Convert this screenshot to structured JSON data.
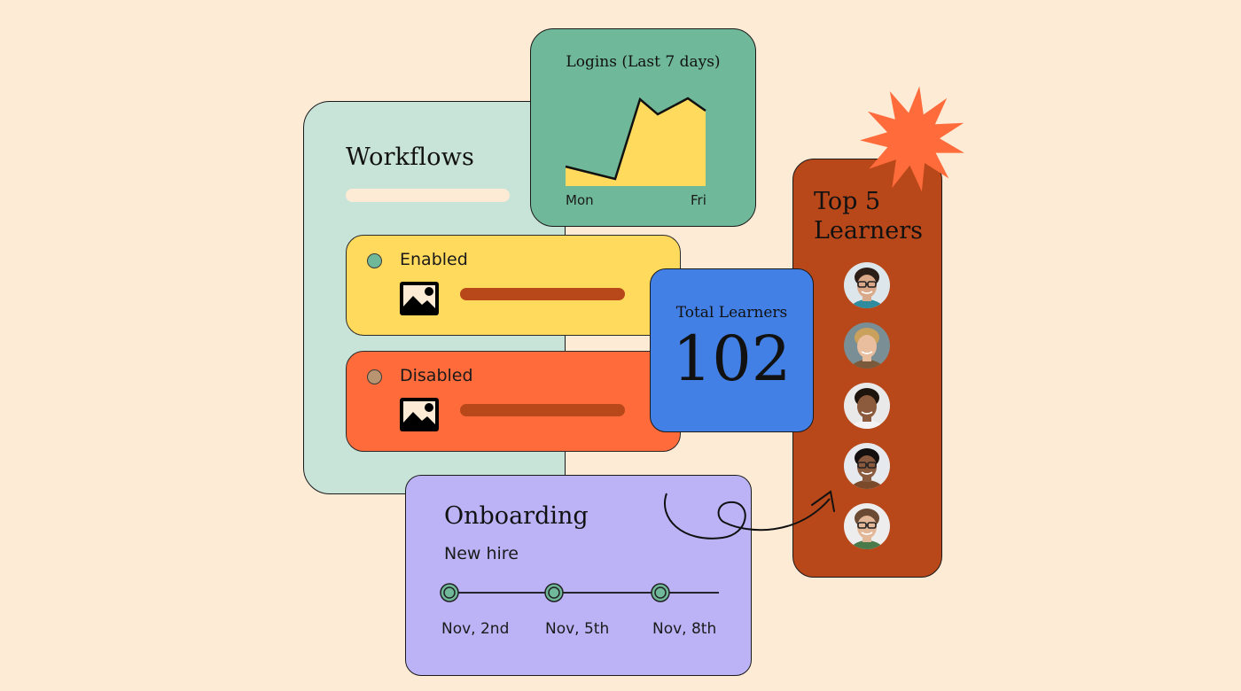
{
  "colors": {
    "background": "#FEEBD6",
    "workflows_panel": "#C8E3D8",
    "enabled_card": "#FFDA5C",
    "disabled_card": "#FF6B3A",
    "enabled_dot": "#6FB899",
    "disabled_dot": "#B89570",
    "logins_card": "#6FB899",
    "chart_fill": "#FFDA5C",
    "total_card": "#4280E6",
    "top5_card": "#B8481A",
    "starburst": "#FF6B3A",
    "onboarding_card": "#BCB3F7",
    "timeline_dot": "#6FB899"
  },
  "workflows": {
    "title": "Workflows",
    "items": [
      {
        "status": "Enabled",
        "icon": "image-icon"
      },
      {
        "status": "Disabled",
        "icon": "image-icon"
      }
    ]
  },
  "logins": {
    "title": "Logins (Last 7 days)",
    "x_start_label": "Mon",
    "x_end_label": "Fri"
  },
  "chart_data": {
    "type": "area",
    "title": "Logins (Last 7 days)",
    "x": [
      "Mon",
      "",
      "",
      "",
      "",
      "Fri"
    ],
    "values": [
      22,
      8,
      98,
      81,
      99,
      85
    ],
    "xlabel": "",
    "ylabel": "",
    "ylim": [
      0,
      110
    ],
    "grid": false,
    "tick_labels": [
      "Mon",
      "Fri"
    ]
  },
  "total_learners": {
    "label": "Total Learners",
    "value": "102"
  },
  "top_learners": {
    "title_line1": "Top 5",
    "title_line2": "Learners",
    "avatars": [
      {
        "name": "avatar-1",
        "skin": "#D9A98A",
        "hair": "#2B1E16",
        "bg": "#DDE6EA",
        "shirt": "#2E8C9E",
        "glasses": true
      },
      {
        "name": "avatar-2",
        "skin": "#E8BE9E",
        "hair": "#C9A15C",
        "bg": "#7A8F95",
        "shirt": "#7A5A3A",
        "glasses": false
      },
      {
        "name": "avatar-3",
        "skin": "#8C5A3C",
        "hair": "#1E140E",
        "bg": "#E9E9E9",
        "shirt": "#F3F3F3",
        "glasses": false
      },
      {
        "name": "avatar-4",
        "skin": "#8A5A3E",
        "hair": "#141010",
        "bg": "#E6EAEE",
        "shirt": "#7A4A2A",
        "glasses": true
      },
      {
        "name": "avatar-5",
        "skin": "#E2B898",
        "hair": "#6A4A32",
        "bg": "#EDEDED",
        "shirt": "#4A7A4A",
        "glasses": true
      }
    ]
  },
  "onboarding": {
    "title": "Onboarding",
    "subtitle": "New hire",
    "milestones": [
      "Nov, 2nd",
      "Nov, 5th",
      "Nov, 8th"
    ]
  }
}
